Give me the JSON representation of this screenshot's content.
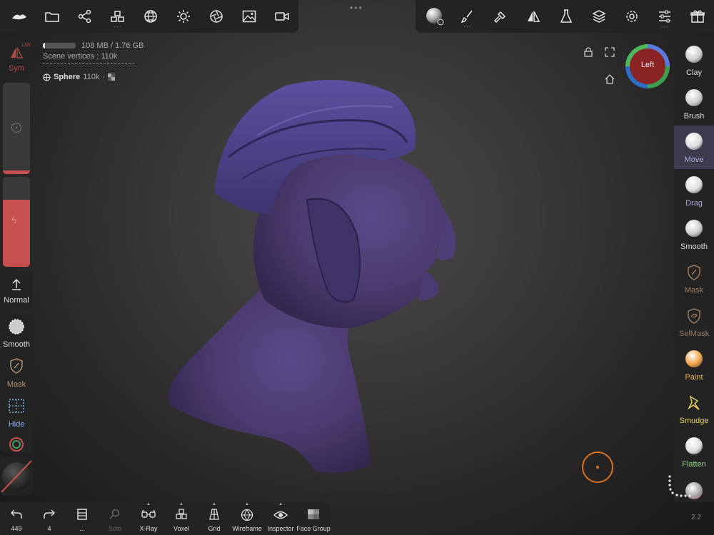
{
  "top_left_toolbar": {
    "icons": [
      "app-logo-icon",
      "folder-icon",
      "scene-graph-icon",
      "boxes-icon",
      "mesh-sphere-icon",
      "sun-icon",
      "aperture-icon",
      "image-icon",
      "video-icon"
    ]
  },
  "top_right_toolbar": {
    "icons": [
      "material-sphere-icon",
      "paint-brush-icon",
      "hammer-icon",
      "symmetry-icon",
      "flask-icon",
      "layers-icon",
      "gear-icon",
      "sliders-icon",
      "gift-icon"
    ]
  },
  "info": {
    "memory": "108 MB / 1.76 GB",
    "memory_fraction": 0.06,
    "vertices": "Scene vertices : 110k",
    "object_name": "Sphere",
    "object_vertices": "110k"
  },
  "left": {
    "sym_label": "Sym",
    "sym_sub": "L/W",
    "radius_fraction": 0.04,
    "intensity_fraction": 0.75,
    "normal_label": "Normal",
    "tools": [
      {
        "label": "Smooth",
        "icon": "smooth-icon",
        "color": "#dddddd"
      },
      {
        "label": "Mask",
        "icon": "mask-shield-icon",
        "color": "#b09070"
      },
      {
        "label": "Hide",
        "icon": "hide-grid-icon",
        "color": "#8ab4e8"
      }
    ]
  },
  "gizmo": {
    "label": "Left"
  },
  "right_tools": [
    {
      "label": "Clay",
      "color": "#dddddd",
      "ball": "#cccccc"
    },
    {
      "label": "Brush",
      "color": "#dddddd",
      "ball": "#cccccc"
    },
    {
      "label": "Move",
      "color": "#a8a8e0",
      "ball": "#dddddd"
    },
    {
      "label": "Drag",
      "color": "#a8a8e0",
      "ball": "#dddddd"
    },
    {
      "label": "Smooth",
      "color": "#dddddd",
      "ball": "#cccccc"
    },
    {
      "label": "Mask",
      "color": "#9a7a60",
      "ball": ""
    },
    {
      "label": "SelMask",
      "color": "#9a7a60",
      "ball": ""
    },
    {
      "label": "Paint",
      "color": "#e8b060",
      "ball": "#f0a040"
    },
    {
      "label": "Smudge",
      "color": "#e8d060",
      "ball": ""
    },
    {
      "label": "Flatten",
      "color": "#9ad48a",
      "ball": "#dddddd"
    }
  ],
  "bottom": [
    {
      "label": "449",
      "icon": "undo-icon",
      "dim": false
    },
    {
      "label": "4",
      "icon": "redo-icon",
      "dim": false
    },
    {
      "label": "...",
      "icon": "book-icon",
      "dim": false
    },
    {
      "label": "Solo",
      "icon": "search-icon",
      "dim": true
    },
    {
      "label": "X-Ray",
      "icon": "glasses-icon",
      "dim": false
    },
    {
      "label": "Voxel",
      "icon": "voxel-icon",
      "dim": false
    },
    {
      "label": "Grid",
      "icon": "grid-icon",
      "dim": false
    },
    {
      "label": "Wireframe",
      "icon": "wireframe-icon",
      "dim": false
    },
    {
      "label": "Inspector",
      "icon": "eye-icon",
      "dim": false
    },
    {
      "label": "Face Group",
      "icon": "face-group-icon",
      "dim": false
    }
  ],
  "version": "2.2"
}
